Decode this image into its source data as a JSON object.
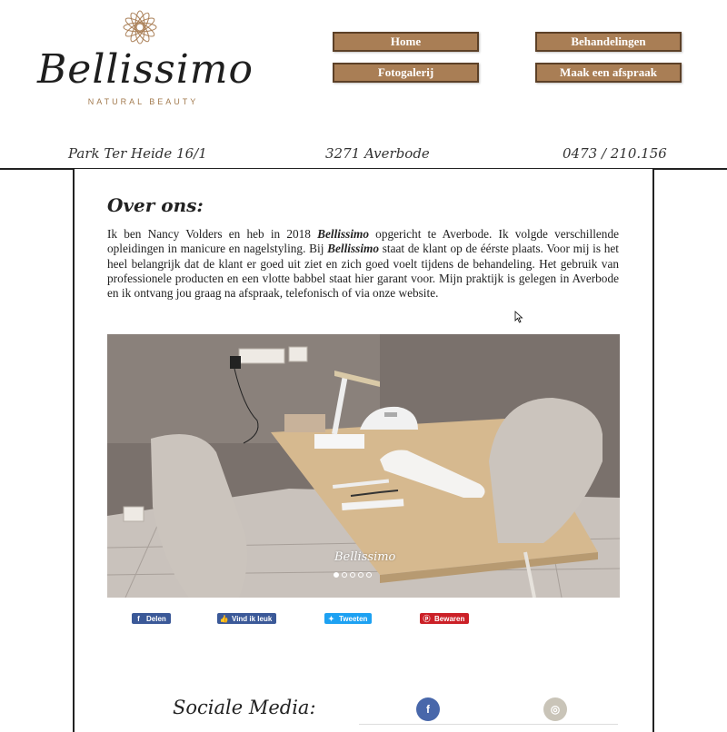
{
  "brand": {
    "name": "Bellissimo",
    "tagline": "NATURAL BEAUTY",
    "accent_color": "#a97e55"
  },
  "nav": {
    "home": "Home",
    "treatments": "Behandelingen",
    "gallery": "Fotogalerij",
    "appointment": "Maak een afspraak"
  },
  "contact": {
    "address": "Park Ter Heide 16/1",
    "city": "3271 Averbode",
    "phone": "0473 / 210.156"
  },
  "about": {
    "title": "Over ons:",
    "text_1": "Ik ben Nancy Volders en heb in 2018 ",
    "brand_1": "Bellissimo",
    "text_2": " opgericht te Averbode. Ik volgde verschillende opleidingen in manicure en nagelstyling. Bij ",
    "brand_2": "Bellissimo",
    "text_3": " staat de klant op de éérste plaats. Voor mij is het heel belangrijk dat de klant er goed uit ziet en zich goed voelt tijdens de behandeling. Het gebruik van professionele producten en een vlotte babbel staat hier garant voor. Mijn praktijk is gelegen in Averbode en ik ontvang jou graag na afspraak, telefonisch of via onze website."
  },
  "slideshow": {
    "caption": "Bellissimo",
    "total_slides": 5,
    "active_slide": 1
  },
  "share": {
    "facebook_share": "Delen",
    "facebook_like": "Vind ik leuk",
    "twitter": "Tweeten",
    "pinterest": "Bewaren",
    "colors": {
      "facebook": "#3b5998",
      "twitter": "#1da1f2",
      "pinterest": "#cb2027"
    }
  },
  "social": {
    "title": "Sociale Media:",
    "facebook_glyph": "f",
    "instagram_glyph": "◎",
    "facebook_icon": "facebook-icon",
    "instagram_icon": "instagram-icon",
    "colors": {
      "facebook": "#4867aa",
      "instagram": "#c9c4b8"
    }
  }
}
